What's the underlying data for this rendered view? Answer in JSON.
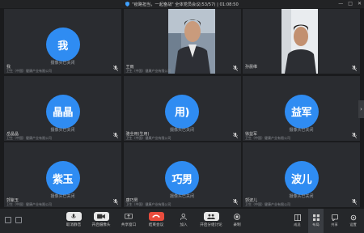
{
  "window": {
    "title": "\"疫路担当，一起奋战\" 全体党员会议(53/57) | 01:08:50"
  },
  "tiles": [
    {
      "avatar": "我",
      "name": "我",
      "org": "卫生（中国）健康产业有限公司",
      "camera": "摄像头已关闭"
    },
    {
      "avatar": "",
      "name": "王雨",
      "org": "卫生（中国）健康产业有限公司",
      "camera": ""
    },
    {
      "avatar": "",
      "name": "孙晨维",
      "org": "",
      "camera": ""
    },
    {
      "avatar": "晶晶",
      "name": "岳晶晶",
      "org": "卫生（中国）健康产业有限公司",
      "camera": "摄像头已关闭"
    },
    {
      "avatar": "用)",
      "name": "骆全用(生用)",
      "org": "卫生（中国）健康产业有限公司",
      "camera": "摄像头已关闭"
    },
    {
      "avatar": "益军",
      "name": "徐益军",
      "org": "卫生（中国）健康产业有限公司",
      "camera": "摄像头已关闭"
    },
    {
      "avatar": "紫玉",
      "name": "郭紫玉",
      "org": "卫生（中国）健康产业有限公司",
      "camera": "摄像头已关闭"
    },
    {
      "avatar": "巧男",
      "name": "康巧男",
      "org": "卫生（中国）健康产业有限公司",
      "camera": "摄像头已关闭"
    },
    {
      "avatar": "波儿",
      "name": "郭波儿",
      "org": "卫生（中国）健康产业有限公司",
      "camera": "摄像头已关闭"
    }
  ],
  "toolbar": {
    "mute": "取消静音",
    "camera": "开启摄像头",
    "share": "共享窗口",
    "end": "结束会议",
    "add": "加入",
    "breakout": "开启分组讨论",
    "record": "录制"
  },
  "side": {
    "members": "成员",
    "layout": "布局",
    "chat": "共享",
    "settings": "设置"
  },
  "colors": {
    "accent": "#2f8cf2",
    "danger": "#e84c3d",
    "background": "#1a1b1d",
    "tile": "#2a2c30"
  }
}
